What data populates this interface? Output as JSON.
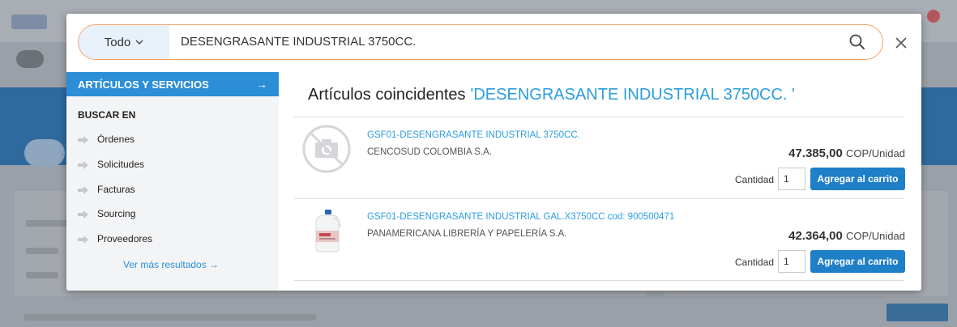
{
  "search": {
    "scope_label": "Todo",
    "query": "DESENGRASANTE INDUSTRIAL 3750CC."
  },
  "sidebar": {
    "header_label": "ARTÍCULOS Y SERVICIOS",
    "header_arrow": "→",
    "section_title": "BUSCAR EN",
    "items": [
      {
        "label": "Órdenes"
      },
      {
        "label": "Solicitudes"
      },
      {
        "label": "Facturas"
      },
      {
        "label": "Sourcing"
      },
      {
        "label": "Proveedores"
      }
    ],
    "more_label": "Ver más resultados →"
  },
  "results": {
    "heading": "Artículos coincidentes",
    "heading_query": "'DESENGRASANTE INDUSTRIAL 3750CC. '",
    "items": [
      {
        "title": "GSF01-DESENGRASANTE INDUSTRIAL 3750CC.",
        "supplier": "CENCOSUD COLOMBIA S.A.",
        "price": "47.385,00",
        "unit": "COP/Unidad",
        "qty_label": "Cantidad",
        "qty": "1",
        "add_label": "Agregar al carrito",
        "image": "no-image-icon"
      },
      {
        "title": "GSF01-DESENGRASANTE INDUSTRIAL GAL.X3750CC cod: 900500471",
        "supplier": "PANAMERICANA LIBRERÍA Y PAPELERÍA S.A.",
        "price": "42.364,00",
        "unit": "COP/Unidad",
        "qty_label": "Cantidad",
        "qty": "1",
        "add_label": "Agregar al carrito",
        "image": "product-jug-image"
      }
    ]
  },
  "colors": {
    "accent": "#2b8ed6",
    "link": "#2b9de0",
    "button": "#1f7fc7",
    "search_border": "#f0a36b"
  }
}
